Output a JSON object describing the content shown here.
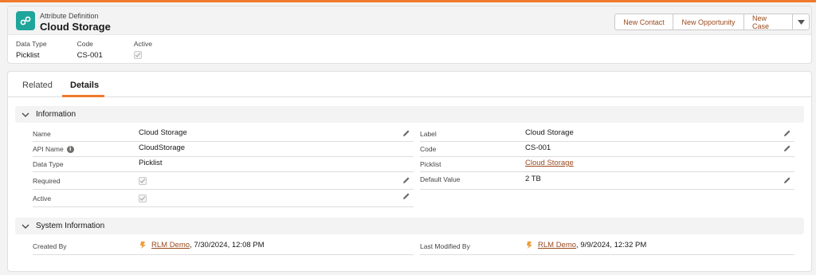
{
  "header": {
    "object_type": "Attribute Definition",
    "title": "Cloud Storage",
    "icon": "attribute-definition-icon",
    "buttons": [
      "New Contact",
      "New Opportunity",
      "New Case"
    ],
    "highlights": [
      {
        "label": "Data Type",
        "value": "Picklist"
      },
      {
        "label": "Code",
        "value": "CS-001"
      },
      {
        "label": "Active",
        "checked": true
      }
    ]
  },
  "tabs": {
    "related": "Related",
    "details": "Details",
    "active": "Details"
  },
  "information": {
    "title": "Information",
    "left": [
      {
        "label": "Name",
        "value": "Cloud Storage",
        "editable": true
      },
      {
        "label": "API Name",
        "value": "CloudStorage",
        "editable": false,
        "info": true
      },
      {
        "label": "Data Type",
        "value": "Picklist",
        "editable": false
      },
      {
        "label": "Required",
        "checked": true,
        "editable": true
      },
      {
        "label": "Active",
        "checked": true,
        "editable": true
      }
    ],
    "right": [
      {
        "label": "Label",
        "value": "Cloud Storage",
        "editable": true
      },
      {
        "label": "Code",
        "value": "CS-001",
        "editable": true
      },
      {
        "label": "Picklist",
        "value": "Cloud Storage",
        "editable": false,
        "link": true
      },
      {
        "label": "Default Value",
        "value": "2 TB",
        "editable": true
      }
    ]
  },
  "system_information": {
    "title": "System Information",
    "created_by": {
      "label": "Created By",
      "user": "RLM Demo",
      "date": ", 7/30/2024, 12:08 PM"
    },
    "last_modified_by": {
      "label": "Last Modified By",
      "user": "RLM Demo",
      "date": ", 9/9/2024, 12:32 PM"
    }
  },
  "colors": {
    "accent": "#f07a2b",
    "link": "#9a4a1f",
    "icon_bg": "#1fa59a"
  }
}
